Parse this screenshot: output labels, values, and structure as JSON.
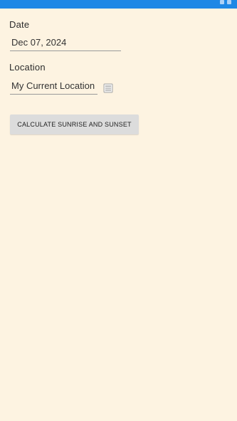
{
  "colors": {
    "status_bar": "#1e88e5",
    "background": "#fdf3e1",
    "button": "#dcdcdc"
  },
  "form": {
    "date_label": "Date",
    "date_value": "Dec 07, 2024",
    "location_label": "Location",
    "location_value": "My Current Location",
    "location_picker_icon": "map-picker-icon"
  },
  "actions": {
    "calculate_label": "CALCULATE SUNRISE AND SUNSET"
  }
}
